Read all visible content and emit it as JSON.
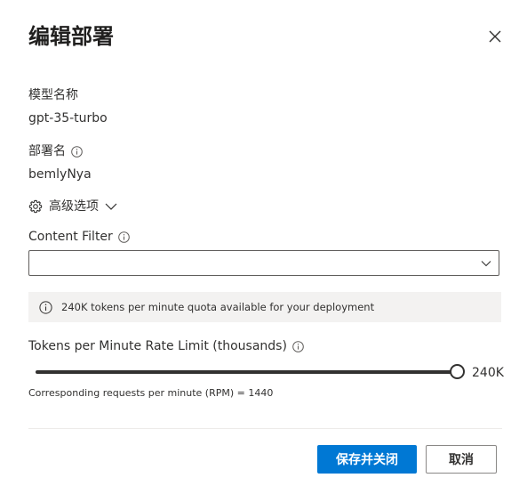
{
  "dialog": {
    "title": "编辑部署",
    "close_icon": "close-icon"
  },
  "model_name": {
    "label": "模型名称",
    "value": "gpt-35-turbo"
  },
  "deployment_name": {
    "label": "部署名",
    "value": "bemlyNya",
    "info_icon": "info-icon"
  },
  "advanced": {
    "label": "高级选项",
    "icon": "gear-icon",
    "chevron": "chevron-down-icon"
  },
  "content_filter": {
    "label": "Content Filter",
    "value": "",
    "info_icon": "info-icon"
  },
  "quota_notice": {
    "icon": "info-icon",
    "text": "240K tokens per minute quota available for your deployment"
  },
  "rate_limit": {
    "label": "Tokens per Minute Rate Limit (thousands)",
    "value_label": "240K",
    "slider_fraction": 1.0,
    "rpm_text": "Corresponding requests per minute (RPM) = 1440"
  },
  "buttons": {
    "save": "保存并关闭",
    "cancel": "取消"
  },
  "colors": {
    "primary": "#0078d4",
    "text": "#323130",
    "notice_bg": "#f3f2f1"
  }
}
